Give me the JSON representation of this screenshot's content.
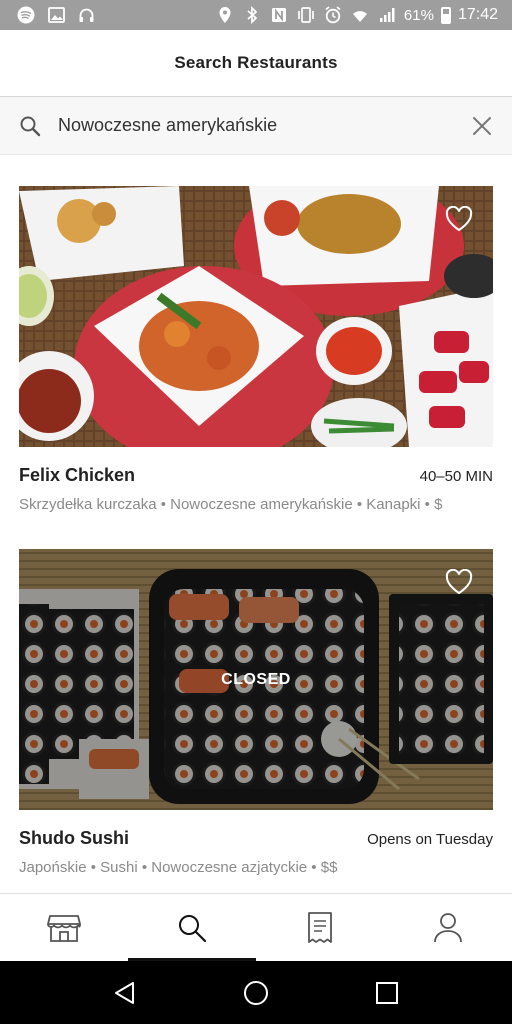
{
  "status_bar": {
    "battery_percent": "61%",
    "time": "17:42",
    "left_icons": [
      "spotify-icon",
      "image-icon",
      "headphones-icon"
    ],
    "right_icons": [
      "location-icon",
      "bluetooth-icon",
      "nfc-icon",
      "vibrate-icon",
      "alarm-icon",
      "wifi-icon",
      "signal-icon",
      "battery-icon"
    ]
  },
  "header": {
    "title": "Search Restaurants"
  },
  "search": {
    "value": "Nowoczesne amerykańskie",
    "icon": "search-icon",
    "clear_icon": "close-icon"
  },
  "restaurants": [
    {
      "name": "Felix Chicken",
      "eta": "40–50 MIN",
      "tags": "Skrzydełka kurczaka • Nowoczesne amerykańskie • Kanapki • $",
      "closed": false,
      "favorite_icon": "heart-outline-icon"
    },
    {
      "name": "Shudo Sushi",
      "eta": "Opens on Tuesday",
      "tags": "Japońskie • Sushi • Nowoczesne azjatyckie • $$",
      "closed": true,
      "closed_label": "CLOSED",
      "favorite_icon": "heart-outline-icon"
    }
  ],
  "bottom_nav": {
    "items": [
      "store-icon",
      "search-icon",
      "receipt-icon",
      "profile-icon"
    ],
    "active": "search-icon"
  },
  "android_nav": [
    "back-icon",
    "home-icon",
    "recents-icon"
  ],
  "colors": {
    "status_bar": "#9e9e9e",
    "text_primary": "#222222",
    "text_secondary": "#8a8a8a",
    "search_bg": "#f7f7f7"
  }
}
